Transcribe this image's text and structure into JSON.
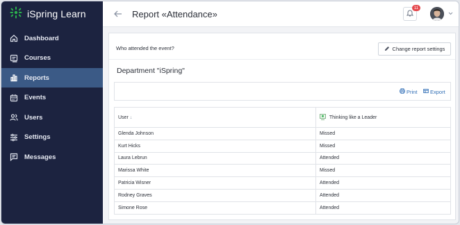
{
  "app": {
    "name": "iSpring Learn",
    "brand_color": "#2bb24c"
  },
  "sidebar": {
    "items": [
      {
        "label": "Dashboard",
        "icon": "home-icon",
        "active": false
      },
      {
        "label": "Courses",
        "icon": "courses-icon",
        "active": false
      },
      {
        "label": "Reports",
        "icon": "reports-icon",
        "active": true
      },
      {
        "label": "Events",
        "icon": "calendar-icon",
        "active": false
      },
      {
        "label": "Users",
        "icon": "users-icon",
        "active": false
      },
      {
        "label": "Settings",
        "icon": "sliders-icon",
        "active": false
      },
      {
        "label": "Messages",
        "icon": "messages-icon",
        "active": false
      }
    ]
  },
  "header": {
    "title": "Report «Attendance»",
    "notifications_count": "11"
  },
  "report": {
    "question": "Who attended the event?",
    "change_settings_label": "Change report settings",
    "department": "Department \"iSpring\"",
    "print_label": "Print",
    "export_label": "Export",
    "columns": [
      "User",
      "Thinking like a Leader"
    ],
    "rows": [
      [
        "Glenda Johnson",
        "Missed"
      ],
      [
        "Kurt Hicks",
        "Missed"
      ],
      [
        "Laura Lebrun",
        "Attended"
      ],
      [
        "Marissa White",
        "Missed"
      ],
      [
        "Patricia Wisner",
        "Attended"
      ],
      [
        "Rodney Graves",
        "Attended"
      ],
      [
        "Simone Rose",
        "Attended"
      ]
    ]
  }
}
